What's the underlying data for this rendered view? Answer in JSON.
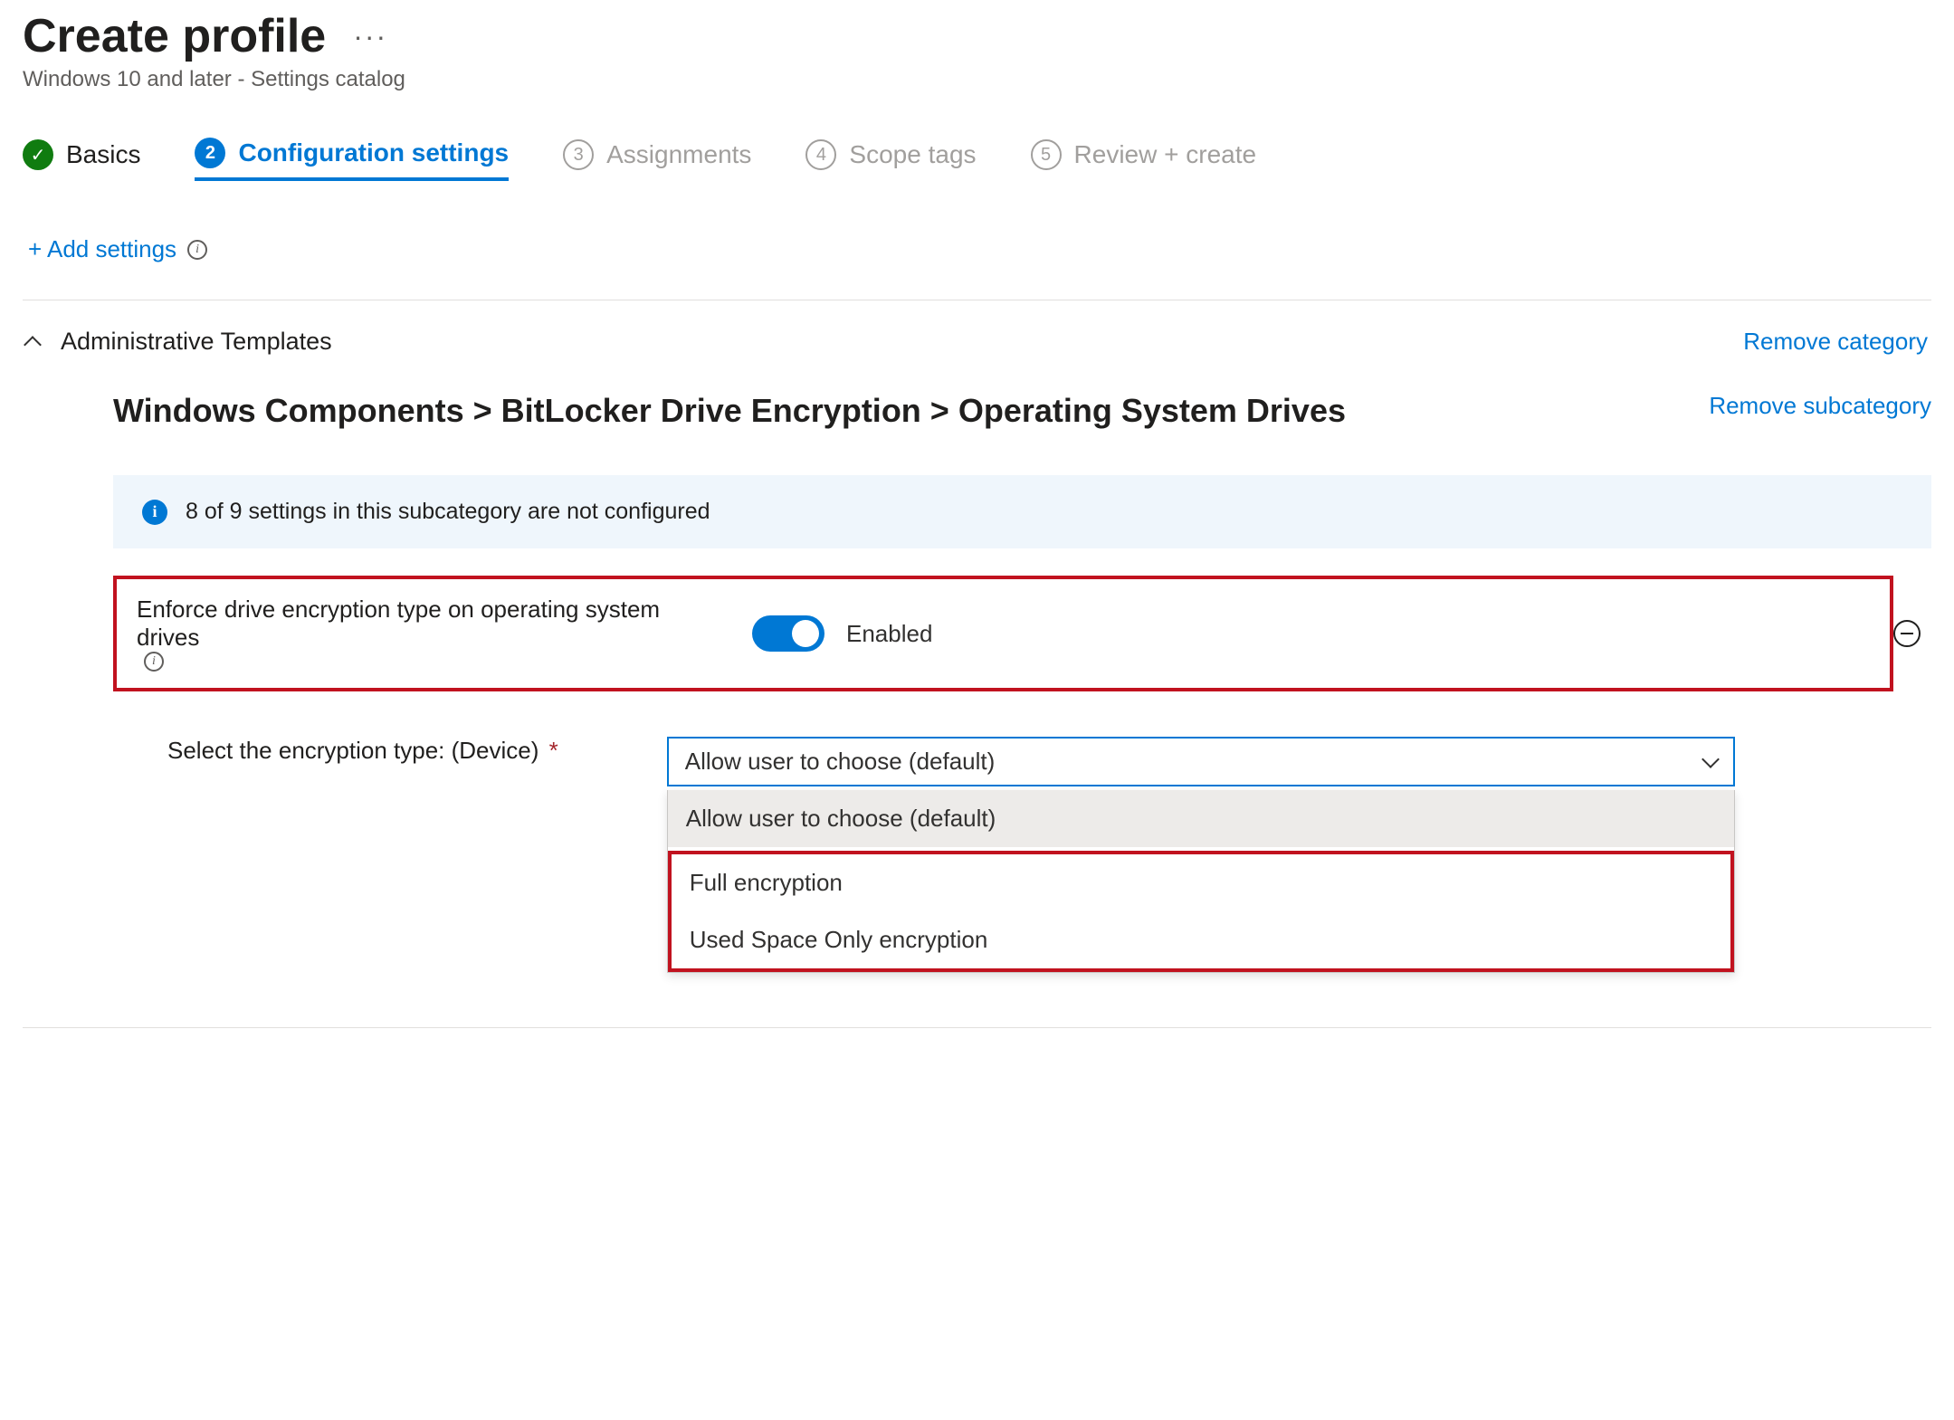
{
  "header": {
    "title": "Create profile",
    "more": "···",
    "subtitle": "Windows 10 and later - Settings catalog"
  },
  "wizard": {
    "steps": [
      {
        "num": "✓",
        "label": "Basics",
        "state": "done"
      },
      {
        "num": "2",
        "label": "Configuration settings",
        "state": "current"
      },
      {
        "num": "3",
        "label": "Assignments",
        "state": "todo"
      },
      {
        "num": "4",
        "label": "Scope tags",
        "state": "todo"
      },
      {
        "num": "5",
        "label": "Review + create",
        "state": "todo"
      }
    ]
  },
  "add_settings": {
    "label": "+ Add settings"
  },
  "category": {
    "title": "Administrative Templates",
    "remove_label": "Remove category"
  },
  "subcategory": {
    "title": "Windows Components > BitLocker Drive Encryption > Operating System Drives",
    "remove_label": "Remove subcategory"
  },
  "banner": {
    "text": "8 of 9 settings in this subcategory are not configured"
  },
  "setting": {
    "name": "Enforce drive encryption type on operating system drives",
    "toggle_state": "Enabled"
  },
  "field": {
    "label": "Select the encryption type: (Device)",
    "required": "*",
    "selected": "Allow user to choose (default)",
    "options": [
      "Allow user to choose (default)",
      "Full encryption",
      "Used Space Only encryption"
    ]
  }
}
